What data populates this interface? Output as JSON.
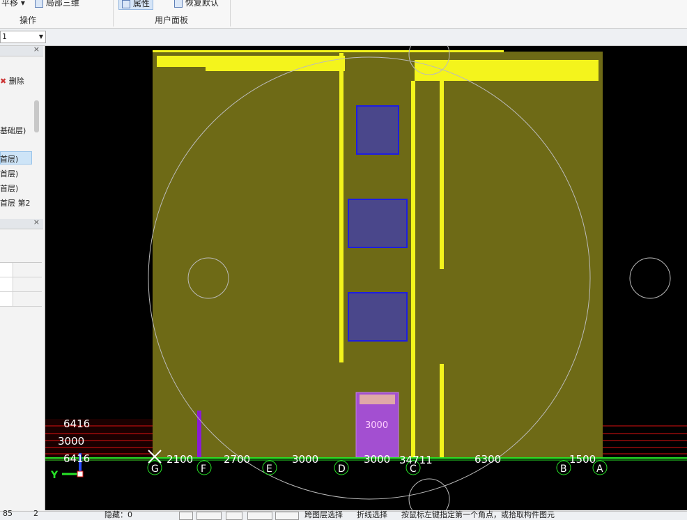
{
  "ribbon": {
    "item_move": "平移",
    "item_local3d": "局部三维",
    "item_props": "属性",
    "item_restore": "恢复默认",
    "group_ops": "操作",
    "group_user_panel": "用户面板"
  },
  "combo": {
    "value": "1"
  },
  "left_panel": {
    "delete_label": "删除",
    "floors": [
      "基础层)",
      "首层)",
      "首层)",
      "首层)",
      "首层 第2"
    ]
  },
  "canvas": {
    "axis_bottom": [
      {
        "id": "G",
        "dim": "2100"
      },
      {
        "id": "F",
        "dim": "2700"
      },
      {
        "id": "E",
        "dim": "3000"
      },
      {
        "id": "D",
        "dim": "3000"
      },
      {
        "id": "C",
        "dim": "34711"
      },
      {
        "id": "B",
        "dim": "6300"
      },
      {
        "id": "A",
        "dim": "1500"
      }
    ],
    "left_dims": [
      "6416",
      "3000",
      "6416"
    ],
    "inner_dim": "3000",
    "y_label": "Y",
    "colors": {
      "slab": "#6e6a16",
      "beam": "#f4f41c",
      "column_fill": "#4a478b",
      "column_border": "#1e1ee0",
      "purple": "#a34fd1"
    }
  },
  "status": {
    "left_a": "85",
    "left_b": "2",
    "hidden_label": "隐藏：0",
    "cross_layer": "跨图层选择",
    "polyline_select": "折线选择",
    "hint": "按鼠标左键指定第一个角点，或拾取构件图元"
  }
}
